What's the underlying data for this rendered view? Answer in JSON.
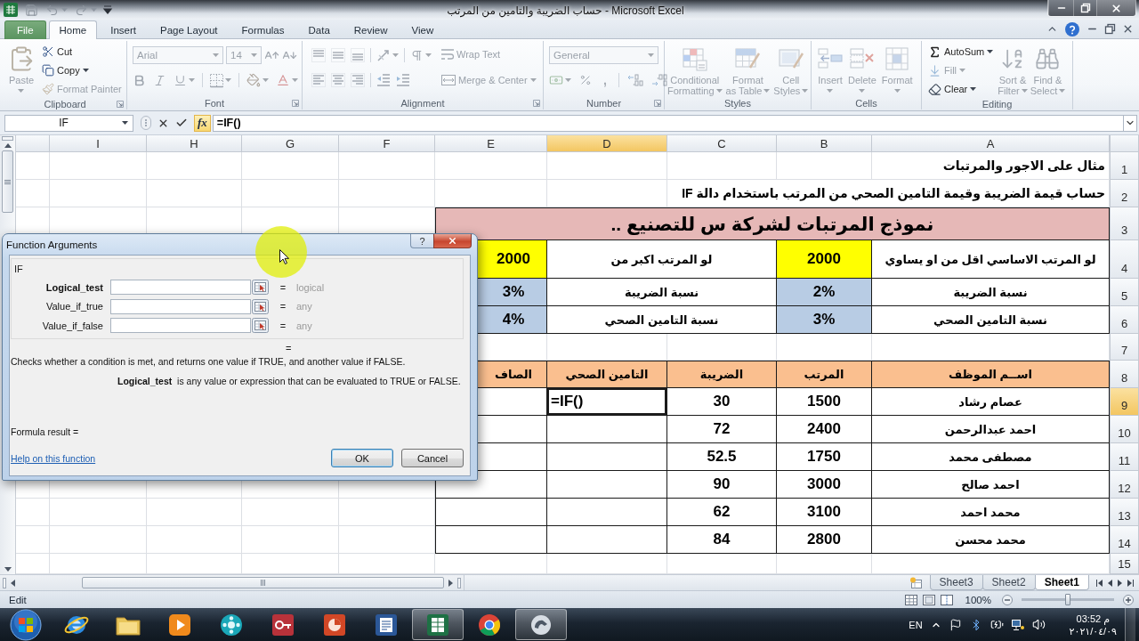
{
  "window": {
    "title": "حساب الضريبة والتامين من المرتب - Microsoft Excel"
  },
  "ribbon_tabs": [
    {
      "kind": "file",
      "label": "File",
      "selected": false
    },
    {
      "kind": "tab",
      "label": "Home",
      "selected": true
    },
    {
      "kind": "tab",
      "label": "Insert",
      "selected": false
    },
    {
      "kind": "tab",
      "label": "Page Layout",
      "selected": false
    },
    {
      "kind": "tab",
      "label": "Formulas",
      "selected": false
    },
    {
      "kind": "tab",
      "label": "Data",
      "selected": false
    },
    {
      "kind": "tab",
      "label": "Review",
      "selected": false
    },
    {
      "kind": "tab",
      "label": "View",
      "selected": false
    }
  ],
  "ribbon_groups": [
    {
      "kind": "clipboard",
      "label": "Clipboard",
      "commands": [
        {
          "lines": [
            "Paste"
          ],
          "disabled": true,
          "dropdown": true
        },
        {
          "lines": [
            "Cut"
          ],
          "disabled": false,
          "dropdown": false
        },
        {
          "lines": [
            "Copy"
          ],
          "disabled": false,
          "dropdown": true
        },
        {
          "lines": [
            "Format Painter"
          ],
          "disabled": true,
          "dropdown": false
        }
      ]
    },
    {
      "kind": "font",
      "label": "Font",
      "icons_disabled": true,
      "fields": [
        {
          "value": "Arial",
          "disabled": true
        },
        {
          "value": "14",
          "disabled": true
        }
      ]
    },
    {
      "kind": "alignment",
      "label": "Alignment",
      "icons_disabled": true,
      "commands": [
        {
          "lines": [
            "Wrap Text"
          ],
          "disabled": true,
          "dropdown": false
        },
        {
          "lines": [
            "Merge & Center"
          ],
          "disabled": true,
          "dropdown": true
        }
      ]
    },
    {
      "kind": "number",
      "label": "Number",
      "icons_disabled": true,
      "fields": [
        {
          "value": "General",
          "disabled": true
        }
      ],
      "comma_style": ","
    },
    {
      "kind": "styles",
      "label": "Styles",
      "commands": [
        {
          "lines": [
            "Conditional",
            "Formatting"
          ],
          "disabled": true,
          "dropdown": true
        },
        {
          "lines": [
            "Format",
            "as Table"
          ],
          "disabled": true,
          "dropdown": true
        },
        {
          "lines": [
            "Cell",
            "Styles"
          ],
          "disabled": true,
          "dropdown": true
        }
      ]
    },
    {
      "kind": "cells",
      "label": "Cells",
      "commands": [
        {
          "lines": [
            "Insert"
          ],
          "disabled": true,
          "dropdown": true
        },
        {
          "lines": [
            "Delete"
          ],
          "disabled": true,
          "dropdown": true
        },
        {
          "lines": [
            "Format"
          ],
          "disabled": true,
          "dropdown": true
        }
      ]
    },
    {
      "kind": "editing",
      "label": "Editing",
      "commands": [
        {
          "lines": [
            "AutoSum"
          ],
          "disabled": false,
          "dropdown": true
        },
        {
          "lines": [
            "Fill"
          ],
          "disabled": true,
          "dropdown": true
        },
        {
          "lines": [
            "Clear"
          ],
          "disabled": false,
          "dropdown": true
        },
        {
          "lines": [
            "Sort &",
            "Filter"
          ],
          "disabled": true,
          "dropdown": true
        },
        {
          "lines": [
            "Find &",
            "Select"
          ],
          "disabled": true,
          "dropdown": true
        }
      ]
    }
  ],
  "formula_bar": {
    "name_box": "IF",
    "function_button": {
      "label": "fx",
      "highlighted": true
    },
    "formula": "=IF()"
  },
  "sheet": {
    "column_headers": [
      {
        "label": "I",
        "selected": false
      },
      {
        "label": "H",
        "selected": false
      },
      {
        "label": "G",
        "selected": false
      },
      {
        "label": "F",
        "selected": false
      },
      {
        "label": "E",
        "selected": false
      },
      {
        "label": "D",
        "selected": true
      },
      {
        "label": "C",
        "selected": false
      },
      {
        "label": "B",
        "selected": false
      },
      {
        "label": "A",
        "selected": false
      }
    ],
    "row_headers": [
      {
        "label": "1",
        "selected": false
      },
      {
        "label": "2",
        "selected": false
      },
      {
        "label": "3",
        "selected": false
      },
      {
        "label": "4",
        "selected": false
      },
      {
        "label": "5",
        "selected": false
      },
      {
        "label": "6",
        "selected": false
      },
      {
        "label": "7",
        "selected": false
      },
      {
        "label": "8",
        "selected": false
      },
      {
        "label": "9",
        "selected": true
      },
      {
        "label": "10",
        "selected": false
      },
      {
        "label": "11",
        "selected": false
      },
      {
        "label": "12",
        "selected": false
      },
      {
        "label": "13",
        "selected": false
      },
      {
        "label": "14",
        "selected": false
      },
      {
        "label": "15",
        "selected": false
      }
    ],
    "title": "مثال على الاجور والمرتبات",
    "subtitle": "حساب قيمة الضريبة وقيمة التامين الصحي من المرتب باستخدام دالة IF",
    "banner": "نموذج المرتبات لشركة س للتصنيع ..",
    "settings": [
      {
        "kind": "threshold",
        "second_value": "2000",
        "second_label": "لو المرتب اكبر من",
        "value": "2000",
        "label": "لو المرتب الاساسي اقل من او يساوي"
      },
      {
        "kind": "rate",
        "second_value": "3%",
        "second_label": "نسبة الضريبة",
        "value": "2%",
        "label": "نسبة الضريبة"
      },
      {
        "kind": "rate",
        "second_value": "4%",
        "second_label": "نسبة التامين الصحي",
        "value": "3%",
        "label": "نسبة التامين الصحي"
      }
    ],
    "table": {
      "columns": [
        "الصاف",
        "التامين الصحي",
        "الضريبة",
        "المرتب",
        "اســم الموظف"
      ],
      "rows": [
        {
          "cells": [
            {
              "selected": false
            },
            {
              "text": "=IF()",
              "selected": true
            },
            {
              "text": "30",
              "selected": false
            },
            {
              "text": "1500",
              "selected": false
            },
            {
              "text": "عصام رشاد",
              "selected": false
            }
          ]
        },
        {
          "cells": [
            {
              "selected": false
            },
            {
              "selected": false
            },
            {
              "text": "72",
              "selected": false
            },
            {
              "text": "2400",
              "selected": false
            },
            {
              "text": "احمد عبدالرحمن",
              "selected": false
            }
          ]
        },
        {
          "cells": [
            {
              "selected": false
            },
            {
              "selected": false
            },
            {
              "text": "52.5",
              "selected": false
            },
            {
              "text": "1750",
              "selected": false
            },
            {
              "text": "مصطفى محمد",
              "selected": false
            }
          ]
        },
        {
          "cells": [
            {
              "selected": false
            },
            {
              "selected": false
            },
            {
              "text": "90",
              "selected": false
            },
            {
              "text": "3000",
              "selected": false
            },
            {
              "text": "احمد صالح",
              "selected": false
            }
          ]
        },
        {
          "cells": [
            {
              "selected": false
            },
            {
              "selected": false
            },
            {
              "text": "62",
              "selected": false
            },
            {
              "text": "3100",
              "selected": false
            },
            {
              "text": "محمد احمد",
              "selected": false
            }
          ]
        },
        {
          "cells": [
            {
              "selected": false
            },
            {
              "selected": false
            },
            {
              "text": "84",
              "selected": false
            },
            {
              "text": "2800",
              "selected": false
            },
            {
              "text": "محمد محسن",
              "selected": false
            }
          ]
        }
      ]
    }
  },
  "sheet_tabs": [
    {
      "label": "Sheet3",
      "selected": false
    },
    {
      "label": "Sheet2",
      "selected": false
    },
    {
      "label": "Sheet1",
      "selected": true
    }
  ],
  "status_bar": {
    "mode": "Edit",
    "zoom": {
      "label": "100%",
      "level": 0.5
    }
  },
  "dialog": {
    "title": "Function Arguments",
    "help_button": "?",
    "function_name": "IF",
    "arguments": [
      {
        "label": "Logical_test",
        "equals": "=",
        "hint": "logical",
        "selected": true
      },
      {
        "label": "Value_if_true",
        "equals": "=",
        "hint": "any",
        "selected": false
      },
      {
        "label": "Value_if_false",
        "equals": "=",
        "hint": "any",
        "selected": false
      }
    ],
    "result_equals": "=",
    "description": "Checks whether a condition is met, and returns one value if TRUE, and another value if FALSE.",
    "argument_help": "**Logical_test**  is any value or expression that can be evaluated to TRUE or FALSE.",
    "formula_result": "Formula result =",
    "help_link": "Help on this function",
    "buttons": [
      {
        "label": "OK",
        "default": true
      },
      {
        "label": "Cancel",
        "default": false
      }
    ]
  },
  "taskbar": {
    "apps": [
      {
        "active": false
      },
      {
        "active": false
      },
      {
        "active": false
      },
      {
        "active": false
      },
      {
        "active": false
      },
      {
        "active": false
      },
      {
        "active": false
      },
      {
        "active": true
      },
      {
        "active": false
      },
      {
        "active": true
      }
    ],
    "language": "EN",
    "time": "03:52 م",
    "date": "٢٠٢١/٠٤/٠٩"
  }
}
